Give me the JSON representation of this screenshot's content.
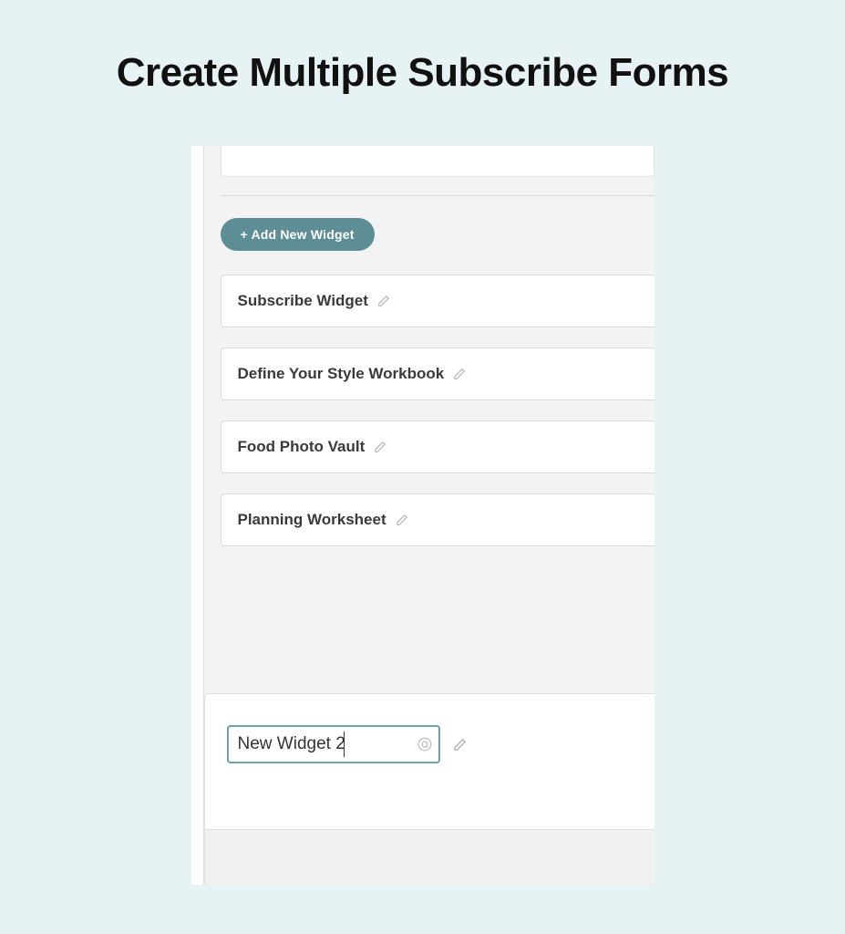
{
  "title": "Create Multiple Subscribe Forms",
  "addWidgetButton": "+ Add New Widget",
  "widgets": [
    {
      "name": "Subscribe Widget"
    },
    {
      "name": "Define Your Style Workbook"
    },
    {
      "name": "Food Photo Vault"
    },
    {
      "name": "Planning Worksheet"
    }
  ],
  "newWidget": {
    "value": "New Widget 2"
  },
  "colors": {
    "accent": "#5d8e95",
    "inputBorder": "#6da2aa"
  }
}
